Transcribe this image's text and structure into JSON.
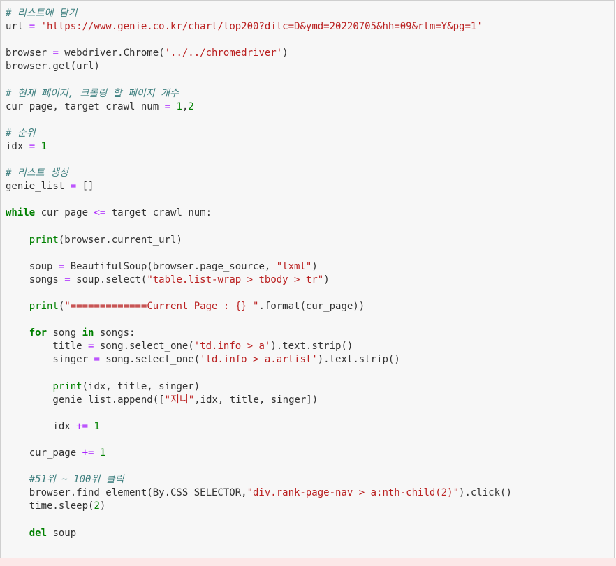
{
  "code_cell": {
    "lines": [
      [
        {
          "t": "# 리스트에 담기",
          "c": "comment"
        }
      ],
      [
        {
          "t": "url ",
          "c": "plain"
        },
        {
          "t": "=",
          "c": "op"
        },
        {
          "t": " ",
          "c": "plain"
        },
        {
          "t": "'https://www.genie.co.kr/chart/top200?ditc=D&ymd=20220705&hh=09&rtm=Y&pg=1'",
          "c": "str"
        }
      ],
      [],
      [
        {
          "t": "browser ",
          "c": "plain"
        },
        {
          "t": "=",
          "c": "op"
        },
        {
          "t": " webdriver.Chrome(",
          "c": "plain"
        },
        {
          "t": "'../../chromedriver'",
          "c": "str"
        },
        {
          "t": ")",
          "c": "plain"
        }
      ],
      [
        {
          "t": "browser.get(url)",
          "c": "plain"
        }
      ],
      [],
      [
        {
          "t": "# 현재 페이지, 크롤링 할 페이지 개수",
          "c": "comment"
        }
      ],
      [
        {
          "t": "cur_page, target_crawl_num ",
          "c": "plain"
        },
        {
          "t": "=",
          "c": "op"
        },
        {
          "t": " ",
          "c": "plain"
        },
        {
          "t": "1",
          "c": "num"
        },
        {
          "t": ",",
          "c": "plain"
        },
        {
          "t": "2",
          "c": "num"
        }
      ],
      [],
      [
        {
          "t": "# 순위",
          "c": "comment"
        }
      ],
      [
        {
          "t": "idx ",
          "c": "plain"
        },
        {
          "t": "=",
          "c": "op"
        },
        {
          "t": " ",
          "c": "plain"
        },
        {
          "t": "1",
          "c": "num"
        }
      ],
      [],
      [
        {
          "t": "# 리스트 생성",
          "c": "comment"
        }
      ],
      [
        {
          "t": "genie_list ",
          "c": "plain"
        },
        {
          "t": "=",
          "c": "op"
        },
        {
          "t": " []",
          "c": "plain"
        }
      ],
      [],
      [
        {
          "t": "while",
          "c": "kw"
        },
        {
          "t": " cur_page ",
          "c": "plain"
        },
        {
          "t": "<=",
          "c": "op"
        },
        {
          "t": " target_crawl_num:",
          "c": "plain"
        }
      ],
      [],
      [
        {
          "t": "    ",
          "c": "plain"
        },
        {
          "t": "print",
          "c": "builtin"
        },
        {
          "t": "(browser.current_url)",
          "c": "plain"
        }
      ],
      [],
      [
        {
          "t": "    soup ",
          "c": "plain"
        },
        {
          "t": "=",
          "c": "op"
        },
        {
          "t": " BeautifulSoup(browser.page_source, ",
          "c": "plain"
        },
        {
          "t": "\"lxml\"",
          "c": "str"
        },
        {
          "t": ")",
          "c": "plain"
        }
      ],
      [
        {
          "t": "    songs ",
          "c": "plain"
        },
        {
          "t": "=",
          "c": "op"
        },
        {
          "t": " soup.select(",
          "c": "plain"
        },
        {
          "t": "\"table.list-wrap > tbody > tr\"",
          "c": "str"
        },
        {
          "t": ")",
          "c": "plain"
        }
      ],
      [],
      [
        {
          "t": "    ",
          "c": "plain"
        },
        {
          "t": "print",
          "c": "builtin"
        },
        {
          "t": "(",
          "c": "plain"
        },
        {
          "t": "\"=============Current Page : {} \"",
          "c": "str"
        },
        {
          "t": ".format(cur_page))",
          "c": "plain"
        }
      ],
      [],
      [
        {
          "t": "    ",
          "c": "plain"
        },
        {
          "t": "for",
          "c": "kw"
        },
        {
          "t": " song ",
          "c": "plain"
        },
        {
          "t": "in",
          "c": "kw"
        },
        {
          "t": " songs:",
          "c": "plain"
        }
      ],
      [
        {
          "t": "        title ",
          "c": "plain"
        },
        {
          "t": "=",
          "c": "op"
        },
        {
          "t": " song.select_one(",
          "c": "plain"
        },
        {
          "t": "'td.info > a'",
          "c": "str"
        },
        {
          "t": ").text.strip()",
          "c": "plain"
        }
      ],
      [
        {
          "t": "        singer ",
          "c": "plain"
        },
        {
          "t": "=",
          "c": "op"
        },
        {
          "t": " song.select_one(",
          "c": "plain"
        },
        {
          "t": "'td.info > a.artist'",
          "c": "str"
        },
        {
          "t": ").text.strip()",
          "c": "plain"
        }
      ],
      [],
      [
        {
          "t": "        ",
          "c": "plain"
        },
        {
          "t": "print",
          "c": "builtin"
        },
        {
          "t": "(idx, title, singer)",
          "c": "plain"
        }
      ],
      [
        {
          "t": "        genie_list.append([",
          "c": "plain"
        },
        {
          "t": "\"지니\"",
          "c": "str"
        },
        {
          "t": ",idx, title, singer])",
          "c": "plain"
        }
      ],
      [],
      [
        {
          "t": "        idx ",
          "c": "plain"
        },
        {
          "t": "+=",
          "c": "op"
        },
        {
          "t": " ",
          "c": "plain"
        },
        {
          "t": "1",
          "c": "num"
        }
      ],
      [],
      [
        {
          "t": "    cur_page ",
          "c": "plain"
        },
        {
          "t": "+=",
          "c": "op"
        },
        {
          "t": " ",
          "c": "plain"
        },
        {
          "t": "1",
          "c": "num"
        }
      ],
      [],
      [
        {
          "t": "    #51위 ~ 100위 클릭",
          "c": "comment"
        }
      ],
      [
        {
          "t": "    browser.find_element(By.CSS_SELECTOR,",
          "c": "plain"
        },
        {
          "t": "\"div.rank-page-nav > a:nth-child(2)\"",
          "c": "str"
        },
        {
          "t": ").click()",
          "c": "plain"
        }
      ],
      [
        {
          "t": "    time.sleep(",
          "c": "plain"
        },
        {
          "t": "2",
          "c": "num"
        },
        {
          "t": ")",
          "c": "plain"
        }
      ],
      [],
      [
        {
          "t": "    ",
          "c": "plain"
        },
        {
          "t": "del",
          "c": "kw"
        },
        {
          "t": " soup",
          "c": "plain"
        }
      ]
    ]
  }
}
